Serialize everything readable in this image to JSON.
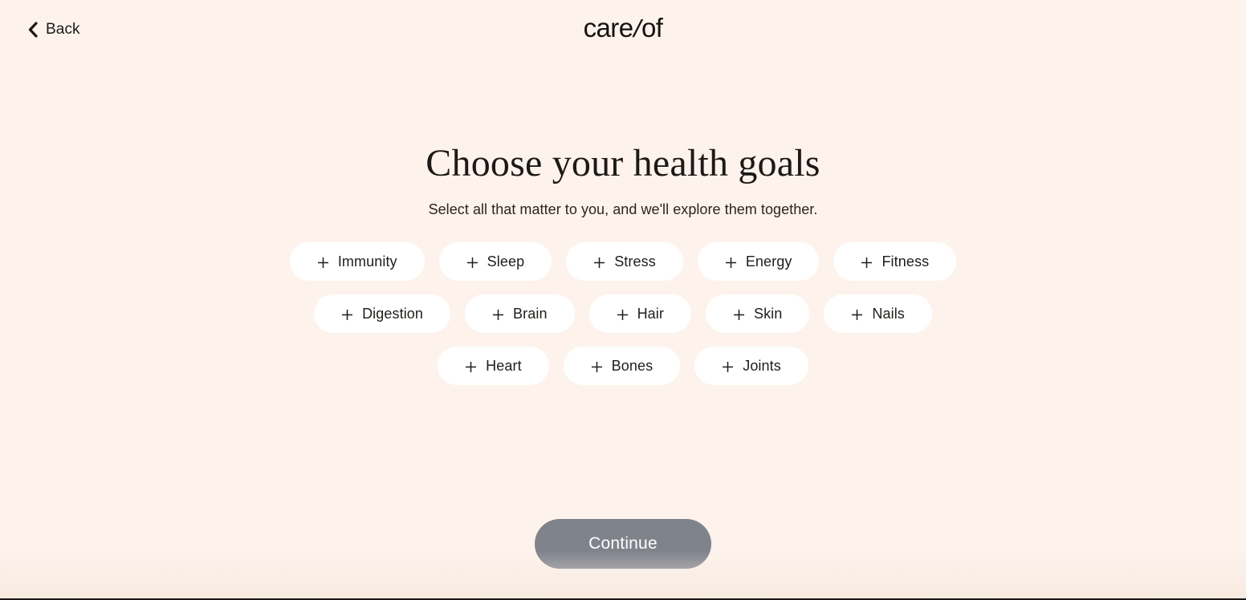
{
  "page": {
    "background_color": "#fdf3ec"
  },
  "header": {
    "back_label": "Back",
    "back_icon": "chevron-left-icon",
    "logo": {
      "part1": "care",
      "slash": "/",
      "part2": "of",
      "full_text": "care/of"
    }
  },
  "main": {
    "title": "Choose your health goals",
    "subtitle": "Select all that matter to you, and we'll explore them together.",
    "goal_rows": [
      [
        {
          "label": "Immunity",
          "icon": "plus-icon",
          "selected": false
        },
        {
          "label": "Sleep",
          "icon": "plus-icon",
          "selected": false
        },
        {
          "label": "Stress",
          "icon": "plus-icon",
          "selected": false
        },
        {
          "label": "Energy",
          "icon": "plus-icon",
          "selected": false
        },
        {
          "label": "Fitness",
          "icon": "plus-icon",
          "selected": false
        }
      ],
      [
        {
          "label": "Digestion",
          "icon": "plus-icon",
          "selected": false
        },
        {
          "label": "Brain",
          "icon": "plus-icon",
          "selected": false
        },
        {
          "label": "Hair",
          "icon": "plus-icon",
          "selected": false
        },
        {
          "label": "Skin",
          "icon": "plus-icon",
          "selected": false
        },
        {
          "label": "Nails",
          "icon": "plus-icon",
          "selected": false
        }
      ],
      [
        {
          "label": "Heart",
          "icon": "plus-icon",
          "selected": false
        },
        {
          "label": "Bones",
          "icon": "plus-icon",
          "selected": false
        },
        {
          "label": "Joints",
          "icon": "plus-icon",
          "selected": false
        }
      ]
    ]
  },
  "footer": {
    "continue_label": "Continue",
    "continue_enabled": false,
    "continue_color": "#7f838c"
  }
}
